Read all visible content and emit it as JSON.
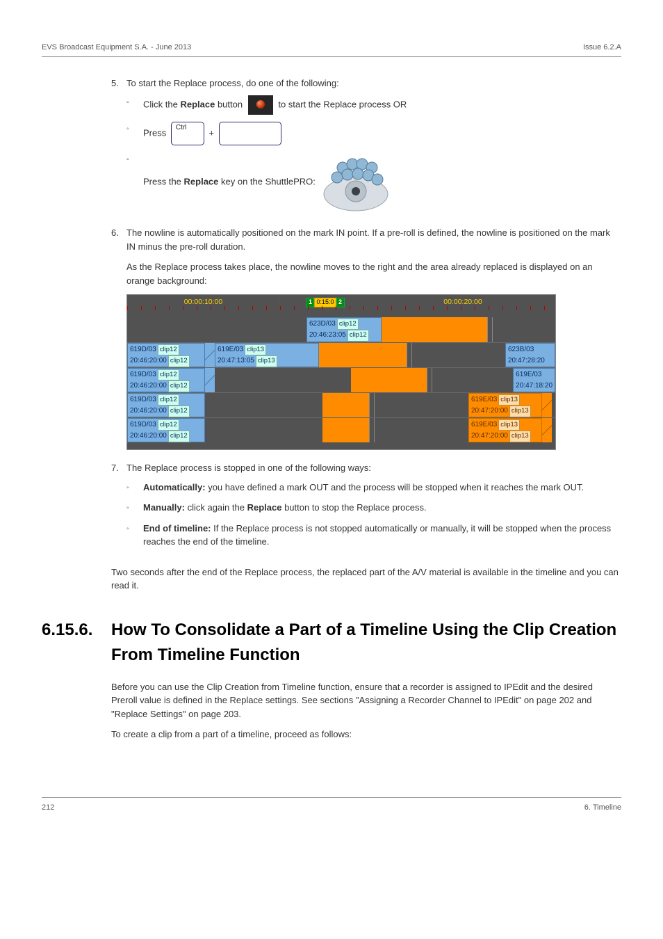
{
  "header": {
    "left": "EVS Broadcast Equipment S.A. - June 2013",
    "right": "Issue 6.2.A"
  },
  "step5": {
    "num": "5.",
    "text": "To start the Replace process, do one of the following:",
    "s1_a": "Click the ",
    "s1_b": "Replace",
    "s1_c": " button ",
    "s1_d": " to start the Replace process OR",
    "s2_a": "Press ",
    "key_ctrl": "Ctrl",
    "plus": " + ",
    "s3_a": "Press the ",
    "s3_b": "Replace",
    "s3_c": " key on the ShuttlePRO: "
  },
  "step6": {
    "num": "6.",
    "p1": "The nowline is automatically positioned on the mark IN point. If a pre-roll is defined, the nowline is positioned on the mark IN minus the pre-roll duration.",
    "p2": "As the Replace process takes place, the nowline moves to the right and the area already replaced is displayed on an orange background:"
  },
  "timeline": {
    "ruler_left": "00:00:10:00",
    "marker1": "1",
    "mid": "0:15:0",
    "marker2": "2",
    "ruler_right": "00:00:20:00",
    "row1": {
      "c1_top": "623D/03",
      "c1_tag": "clip12",
      "c1_btm": "20:46:23:05",
      "c1_btag": "clip12"
    },
    "row2": {
      "l_top": "619D/03",
      "l_tag": "clip12",
      "l_btm": "20:46:20:00",
      "l_btag": "clip12",
      "m_top": "619E/03",
      "m_tag": "clip13",
      "m_btm": "20:47:13:05",
      "m_btag": "clip13",
      "r_top": "623B/03",
      "r_btm": "20:47:28:20"
    },
    "row3": {
      "l_top": "619D/03",
      "l_tag": "clip12",
      "l_btm": "20:46:20:00",
      "l_btag": "clip12",
      "r_top": "619E/03",
      "r_btm": "20:47:18:20"
    },
    "row4": {
      "l_top": "619D/03",
      "l_tag": "clip12",
      "l_btm": "20:46:20:00",
      "l_btag": "clip12",
      "r_top": "619E/03",
      "r_tag": "clip13",
      "r_btm": "20:47:20:00",
      "r_btag": "clip13"
    },
    "row5": {
      "l_top": "619D/03",
      "l_tag": "clip12",
      "l_btm": "20:46:20:00",
      "l_btag": "clip12",
      "r_top": "619E/03",
      "r_tag": "clip13",
      "r_btm": "20:47:20:00",
      "r_btag": "clip13"
    }
  },
  "step7": {
    "num": "7.",
    "text": "The Replace process is stopped in one of the following ways:",
    "s1_b": "Automatically:",
    "s1_t": " you have defined a mark OUT and the process will be stopped when it reaches the mark OUT.",
    "s2_b": "Manually:",
    "s2_t1": " click again the ",
    "s2_b2": "Replace",
    "s2_t2": " button to stop the Replace process.",
    "s3_b": "End of timeline:",
    "s3_t": " If the Replace process is not stopped automatically or manually, it will be stopped when the process reaches the end of the timeline."
  },
  "closing": "Two seconds after the end of the Replace process, the replaced part of the A/V material is available in the timeline and you can read it.",
  "section": {
    "num": "6.15.6.",
    "title": "How To Consolidate a Part of a Timeline Using the Clip Creation From Timeline Function"
  },
  "section_p1": "Before you can use the Clip Creation from Timeline function, ensure that a recorder is assigned to IPEdit and the desired Preroll value is defined in the Replace settings. See sections \"Assigning a Recorder Channel to IPEdit\" on page 202 and \"Replace Settings\" on page 203.",
  "section_p2": "To create a clip from a part of a timeline, proceed as follows:",
  "footer": {
    "left": "212",
    "right": "6. Timeline"
  }
}
